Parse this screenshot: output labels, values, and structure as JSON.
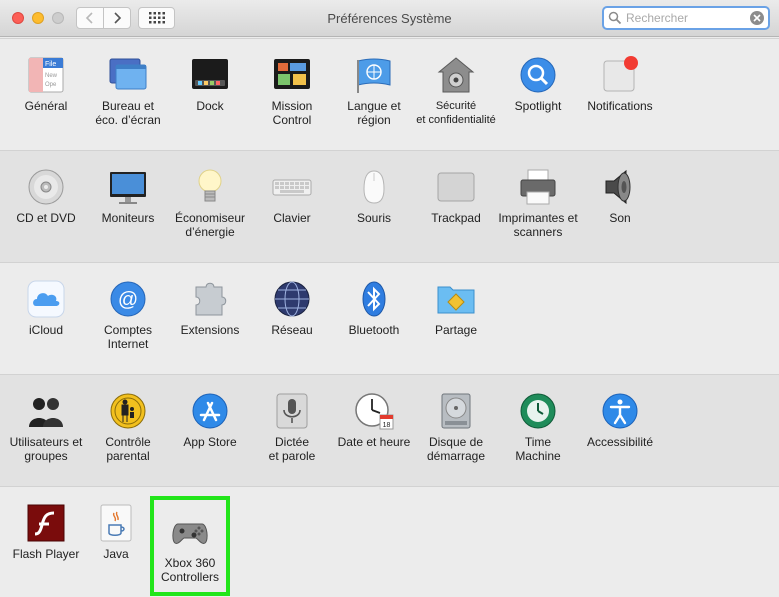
{
  "window": {
    "title": "Préférences Système",
    "search": {
      "placeholder": "Rechercher",
      "value": ""
    }
  },
  "sections": [
    {
      "panes": [
        {
          "label": "Général",
          "icon": "general-icon"
        },
        {
          "label": "Bureau et\néco. d’écran",
          "icon": "desktop-screensaver-icon"
        },
        {
          "label": "Dock",
          "icon": "dock-icon"
        },
        {
          "label": "Mission\nControl",
          "icon": "mission-control-icon"
        },
        {
          "label": "Langue et\nrégion",
          "icon": "language-region-icon"
        },
        {
          "label": "Sécurité\net confidentialité",
          "icon": "security-house-icon"
        },
        {
          "label": "Spotlight",
          "icon": "spotlight-magnifier-icon"
        },
        {
          "label": "Notifications",
          "icon": "notifications-icon"
        }
      ]
    },
    {
      "panes": [
        {
          "label": "CD et DVD",
          "icon": "cd-dvd-icon"
        },
        {
          "label": "Moniteurs",
          "icon": "displays-icon"
        },
        {
          "label": "Économiseur\nd’énergie",
          "icon": "energy-bulb-icon"
        },
        {
          "label": "Clavier",
          "icon": "keyboard-icon"
        },
        {
          "label": "Souris",
          "icon": "mouse-icon"
        },
        {
          "label": "Trackpad",
          "icon": "trackpad-icon"
        },
        {
          "label": "Imprimantes et\nscanners",
          "icon": "printer-icon"
        },
        {
          "label": "Son",
          "icon": "speaker-icon"
        }
      ]
    },
    {
      "panes": [
        {
          "label": "iCloud",
          "icon": "icloud-icon"
        },
        {
          "label": "Comptes\nInternet",
          "icon": "internet-accounts-icon"
        },
        {
          "label": "Extensions",
          "icon": "extensions-puzzle-icon"
        },
        {
          "label": "Réseau",
          "icon": "network-globe-icon"
        },
        {
          "label": "Bluetooth",
          "icon": "bluetooth-icon"
        },
        {
          "label": "Partage",
          "icon": "sharing-folder-icon"
        }
      ]
    },
    {
      "panes": [
        {
          "label": "Utilisateurs et\ngroupes",
          "icon": "users-groups-icon"
        },
        {
          "label": "Contrôle\nparental",
          "icon": "parental-controls-icon"
        },
        {
          "label": "App Store",
          "icon": "app-store-icon"
        },
        {
          "label": "Dictée\net parole",
          "icon": "dictation-microphone-icon"
        },
        {
          "label": "Date et heure",
          "icon": "date-time-clock-icon"
        },
        {
          "label": "Disque de\ndémarrage",
          "icon": "startup-disk-icon"
        },
        {
          "label": "Time\nMachine",
          "icon": "time-machine-icon"
        },
        {
          "label": "Accessibilité",
          "icon": "accessibility-icon"
        }
      ]
    },
    {
      "panes": [
        {
          "label": "Flash Player",
          "icon": "flash-player-icon"
        },
        {
          "label": "Java",
          "icon": "java-cup-icon"
        },
        {
          "label": "Xbox 360\nControllers",
          "icon": "gamepad-icon",
          "highlighted": true
        }
      ]
    }
  ],
  "colors": {
    "highlight": "#22e51a",
    "search_focus": "#6aa2e6"
  }
}
